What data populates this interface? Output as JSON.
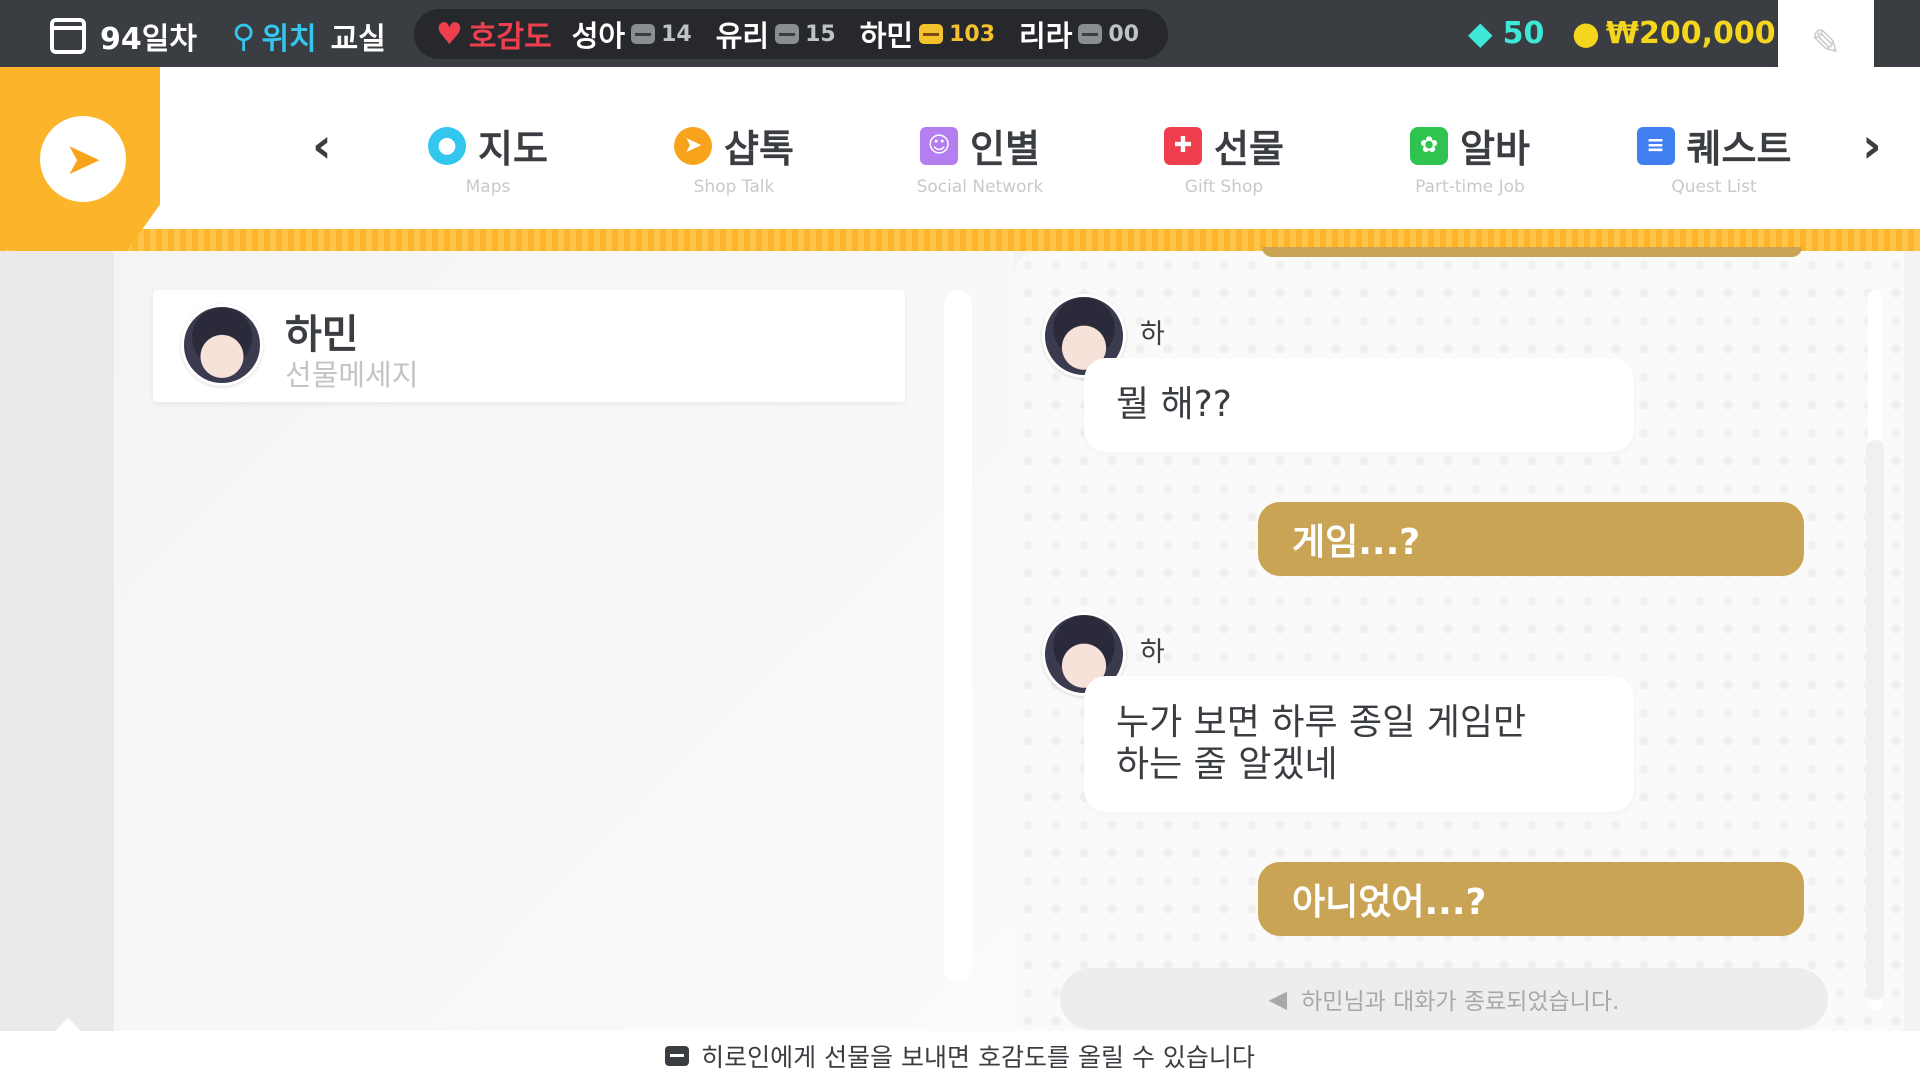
{
  "status": {
    "day": "94일차",
    "location_label": "위치",
    "location_value": "교실",
    "affinity_label": "호감도",
    "characters": [
      {
        "name": "성아",
        "value": "14"
      },
      {
        "name": "유리",
        "value": "15"
      },
      {
        "name": "하민",
        "value": "103"
      },
      {
        "name": "리라",
        "value": "00"
      }
    ],
    "gems": "50",
    "money": "₩200,000"
  },
  "nav": {
    "items": [
      {
        "label": "지도",
        "sub": "Maps",
        "color": "#33c6ee",
        "glyph": "●"
      },
      {
        "label": "샵톡",
        "sub": "Shop Talk",
        "color": "#f8a31c",
        "glyph": "➤"
      },
      {
        "label": "인별",
        "sub": "Social Network",
        "color": "#b57ef0",
        "glyph": "☺"
      },
      {
        "label": "선물",
        "sub": "Gift Shop",
        "color": "#ef3f4f",
        "glyph": "✚"
      },
      {
        "label": "알바",
        "sub": "Part-time Job",
        "color": "#2fc44f",
        "glyph": "✿"
      },
      {
        "label": "퀘스트",
        "sub": "Quest List",
        "color": "#3f7ff0",
        "glyph": "≡"
      }
    ]
  },
  "contact": {
    "name": "하민",
    "subtitle": "선물메세지"
  },
  "chat": {
    "messages": [
      {
        "sender": "하민",
        "text": "뭘 해??"
      },
      {
        "reply": "게임...?"
      },
      {
        "sender": "하민",
        "line1": "누가 보면 하루 종일 게임만",
        "line2": "하는 줄 알겠네"
      },
      {
        "reply": "아니었어...?"
      }
    ],
    "end_notice": "하민님과 대화가 종료되었습니다."
  },
  "hint": "히로인에게 선물을 보내면 호감도를 올릴 수 있습니다"
}
